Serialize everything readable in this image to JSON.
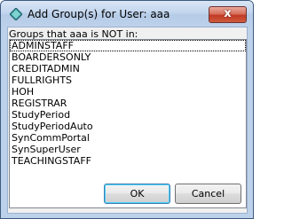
{
  "window": {
    "title": "Add Group(s) for User: aaa",
    "close_label": "x"
  },
  "dialog": {
    "list_label": "Groups that aaa is NOT in:",
    "groups": [
      "ADMINSTAFF",
      "BOARDERSONLY",
      "CREDITADMIN",
      "FULLRIGHTS",
      "HOH",
      "REGISTRAR",
      "StudyPeriod",
      "StudyPeriodAuto",
      "SynCommPortal",
      "SynSuperUser",
      "TEACHINGSTAFF"
    ],
    "ok_label": "OK",
    "cancel_label": "Cancel"
  },
  "icons": {
    "app": "diamond-app-icon",
    "close": "close-icon"
  },
  "colors": {
    "frame": "#bcd1ea",
    "close_button": "#c13a25",
    "client_bg": "#f0f0f0"
  }
}
